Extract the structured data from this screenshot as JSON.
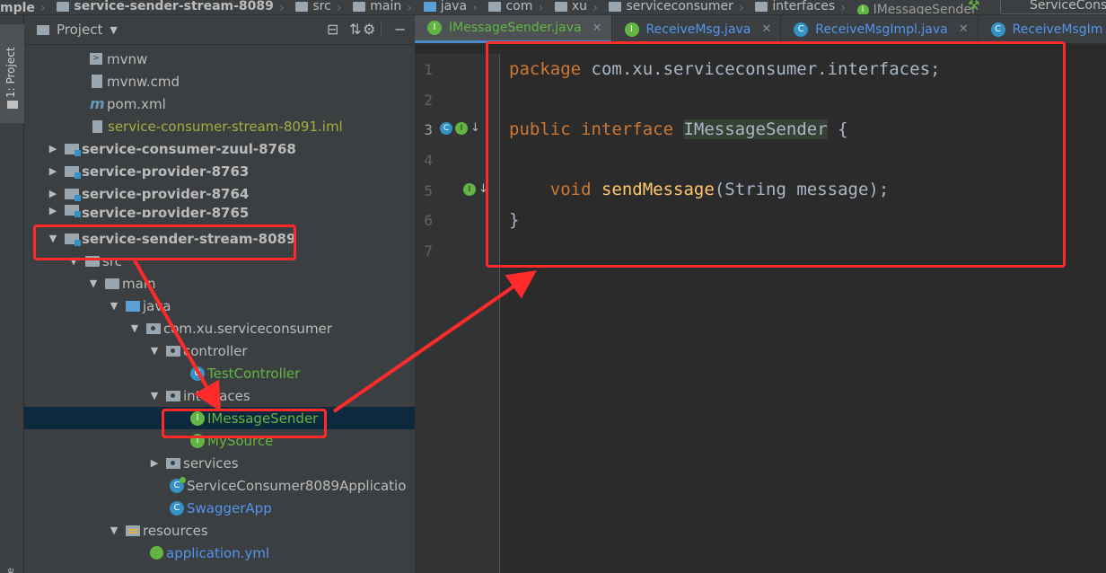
{
  "breadcrumb": {
    "items": [
      {
        "label": "mple",
        "bold": true
      },
      {
        "label": "service-sender-stream-8089",
        "bold": true
      },
      {
        "label": "src"
      },
      {
        "label": "main"
      },
      {
        "label": "java"
      },
      {
        "label": "com"
      },
      {
        "label": "xu"
      },
      {
        "label": "serviceconsumer"
      },
      {
        "label": "interfaces"
      },
      {
        "label": "IMessageSender"
      }
    ],
    "run_config": "ServiceCons"
  },
  "toolstrip": {
    "project_tab": "1: Project",
    "bottom_label": "e"
  },
  "project_panel": {
    "title": "Project",
    "rows": [
      {
        "label": "mvnw"
      },
      {
        "label": "mvnw.cmd"
      },
      {
        "label": "pom.xml"
      },
      {
        "label": "service-consumer-stream-8091.iml"
      },
      {
        "label": "service-consumer-zuul-8768"
      },
      {
        "label": "service-provider-8763"
      },
      {
        "label": "service-provider-8764"
      },
      {
        "label": "service-provider-8765"
      },
      {
        "label": "service-sender-stream-8089"
      },
      {
        "label": "src"
      },
      {
        "label": "main"
      },
      {
        "label": "java"
      },
      {
        "label": "com.xu.serviceconsumer"
      },
      {
        "label": "controller"
      },
      {
        "label": "TestController"
      },
      {
        "label": "interfaces"
      },
      {
        "label": "IMessageSender"
      },
      {
        "label": "MySource"
      },
      {
        "label": "services"
      },
      {
        "label": "ServiceConsumer8089Applicatio"
      },
      {
        "label": "SwaggerApp"
      },
      {
        "label": "resources"
      },
      {
        "label": "application.yml"
      }
    ]
  },
  "editor": {
    "tabs": [
      {
        "label": "IMessageSender.java",
        "active": true
      },
      {
        "label": "ReceiveMsg.java"
      },
      {
        "label": "ReceiveMsgImpl.java"
      },
      {
        "label": "ReceiveMsgIm"
      }
    ],
    "line_numbers": [
      "1",
      "2",
      "3",
      "4",
      "5",
      "6",
      "7"
    ],
    "code": {
      "l1_kw": "package",
      "l1_rest": " com.xu.serviceconsumer.interfaces;",
      "l3_kw1": "public",
      "l3_kw2": " interface ",
      "l3_name": "IMessageSender",
      "l3_rest": " {",
      "l5_indent": "    ",
      "l5_kw": "void",
      "l5_fn": " sendMessage",
      "l5_rest": "(String message);",
      "l6": "}"
    },
    "gutter_icons": {
      "impl": "I",
      "class": "C",
      "arrow": "↓"
    }
  },
  "colors": {
    "annotation_red": "#ff2a2a",
    "keyword": "#cc7832",
    "method": "#ffc66d",
    "selection": "#0d293e"
  }
}
